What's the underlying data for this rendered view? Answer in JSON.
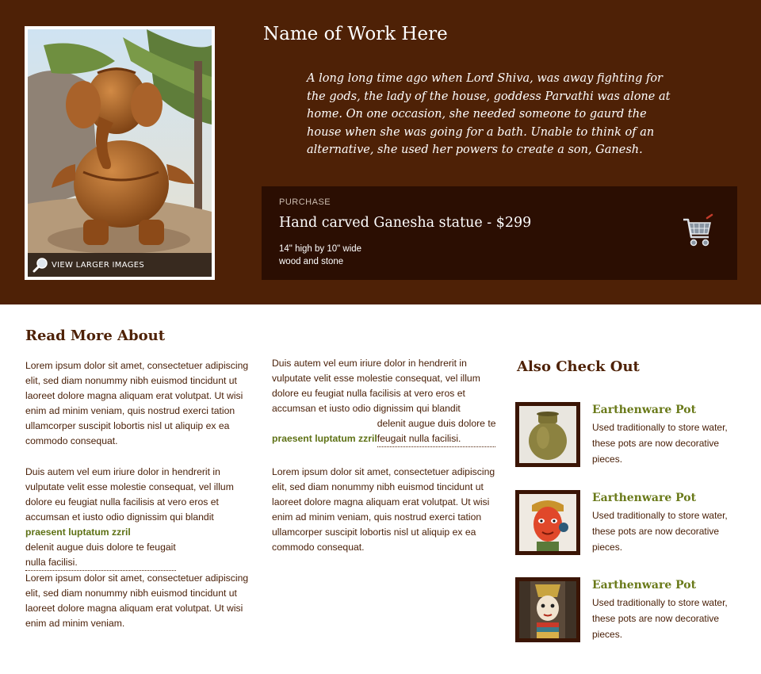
{
  "work": {
    "title": "Name of Work Here",
    "story": "A long long time ago when Lord Shiva, was away fighting for the gods, the lady of the house, goddess Parvathi was alone at home. On one occasion, she needed someone to gaurd the house when she was going for a bath. Unable to think of an alternative, she used her powers to create a son, Ganesh.",
    "view_larger": "VIEW LARGER IMAGES"
  },
  "purchase": {
    "label": "PURCHASE",
    "title": "Hand carved Ganesha statue - $299",
    "dimensions": "14\" high by 10\" wide",
    "material": "wood and stone"
  },
  "read_more": {
    "heading": "Read More About",
    "col1": {
      "p1": "Lorem ipsum dolor sit amet, consectetuer adipiscing elit, sed diam nonummy nibh euismod tincidunt ut laoreet dolore magna aliquam erat volutpat. Ut wisi enim ad minim veniam, quis nostrud exerci tation ullamcorper suscipit lobortis nisl ut aliquip ex ea commodo consequat.",
      "p2_before": "Duis autem vel eum iriure dolor in hendrerit in vulputate velit esse molestie consequat, vel illum dolore eu feugiat nulla facilisis at vero eros et accumsan et iusto odio dignissim qui blandit ",
      "p2_link": "praesent luptatum zzril",
      "p2_mid": " delenit augue duis dolore te feugait",
      "p2_end": "nulla facilisi.",
      "p3": "Lorem ipsum dolor sit amet, consectetuer adipiscing elit, sed diam nonummy nibh euismod tincidunt ut laoreet dolore magna aliquam erat volutpat. Ut wisi enim ad minim veniam."
    },
    "col2": {
      "p1_before": "Duis autem vel eum iriure dolor in hendrerit in vulputate velit esse molestie consequat, vel illum dolore eu feugiat nulla facilisis at vero eros et accumsan et iusto odio dignissim qui blandit ",
      "p1_link": "praesent luptatum zzril",
      "p1_mid": " delenit augue duis dolore te",
      "p1_end": "feugait nulla facilisi.",
      "p2": "Lorem ipsum dolor sit amet, consectetuer adipiscing elit, sed diam nonummy nibh euismod tincidunt ut laoreet dolore magna aliquam erat volutpat. Ut wisi enim ad minim veniam, quis nostrud exerci tation ullamcorper suscipit lobortis nisl ut aliquip ex ea commodo consequat."
    }
  },
  "also": {
    "heading": "Also Check Out",
    "items": [
      {
        "title": "Earthenware Pot",
        "desc": "Used traditionally to store water, these pots are now decorative pieces."
      },
      {
        "title": "Earthenware Pot",
        "desc": "Used traditionally to store water, these pots are now decorative pieces."
      },
      {
        "title": "Earthenware Pot",
        "desc": "Used traditionally to store water, these pots are now decorative pieces."
      }
    ]
  },
  "icons": {
    "magnifier": "magnifier-icon",
    "cart": "shopping-cart-icon"
  },
  "colors": {
    "hero_bg": "#4e2106",
    "purchase_bg": "#2b0e02",
    "heading": "#4e2106",
    "link": "#5e7115",
    "item_title": "#6a7a1a"
  }
}
